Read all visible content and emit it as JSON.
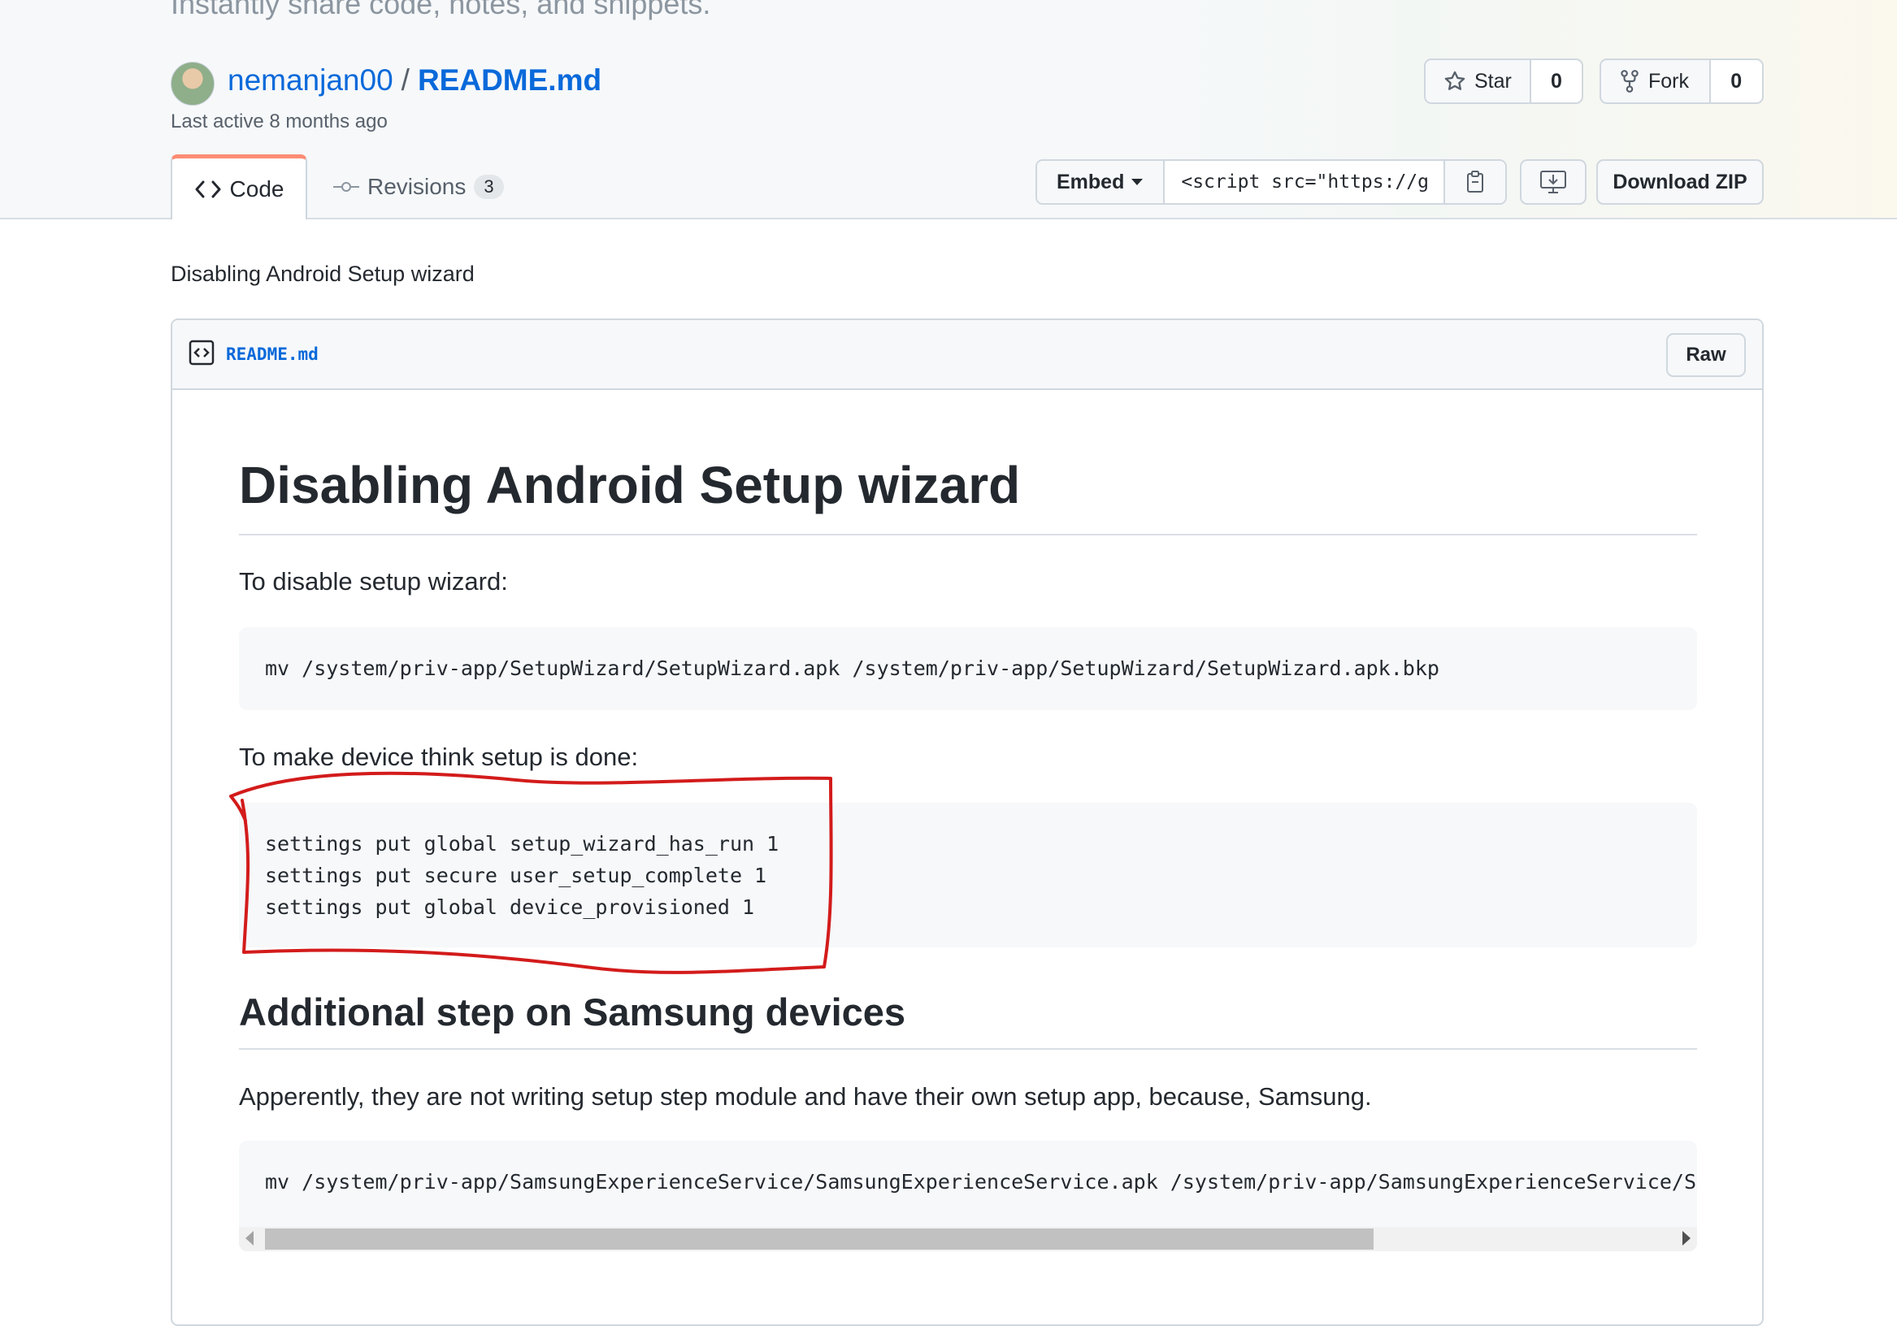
{
  "header": {
    "tagline": "Instantly share code, notes, and snippets.",
    "owner": "nemanjan00",
    "separator": "/",
    "file_title": "README.md",
    "last_active": "Last active 8 months ago"
  },
  "actions": {
    "star_label": "Star",
    "star_count": "0",
    "fork_label": "Fork",
    "fork_count": "0"
  },
  "tabs": {
    "code_label": "Code",
    "revisions_label": "Revisions",
    "revisions_count": "3"
  },
  "embed": {
    "select_label": "Embed",
    "snippet_value": "<script src=\"https://gis",
    "download_label": "Download ZIP"
  },
  "gist": {
    "description": "Disabling Android Setup wizard",
    "file_name": "README.md",
    "raw_label": "Raw"
  },
  "readme": {
    "h1": "Disabling Android Setup wizard",
    "p1": "To disable setup wizard:",
    "code1": "mv /system/priv-app/SetupWizard/SetupWizard.apk /system/priv-app/SetupWizard/SetupWizard.apk.bkp",
    "p2": "To make device think setup is done:",
    "code2": [
      "settings put global setup_wizard_has_run 1",
      "settings put secure user_setup_complete 1",
      "settings put global device_provisioned 1"
    ],
    "h2": "Additional step on Samsung devices",
    "p3": "Apperently, they are not writing setup step module and have their own setup app, because, Samsung.",
    "code3": "mv /system/priv-app/SamsungExperienceService/SamsungExperienceService.apk /system/priv-app/SamsungExperienceService/Sa"
  },
  "icons": {
    "star": "star-icon",
    "fork": "fork-icon",
    "code": "code-icon",
    "revisions": "git-commit-icon",
    "caret": "caret-down-icon",
    "copy": "clipboard-icon",
    "desktop": "desktop-download-icon",
    "file": "file-code-icon"
  },
  "colors": {
    "link": "#0969da",
    "active_tab": "#fd8c73",
    "annotation": "#d31b1b"
  }
}
